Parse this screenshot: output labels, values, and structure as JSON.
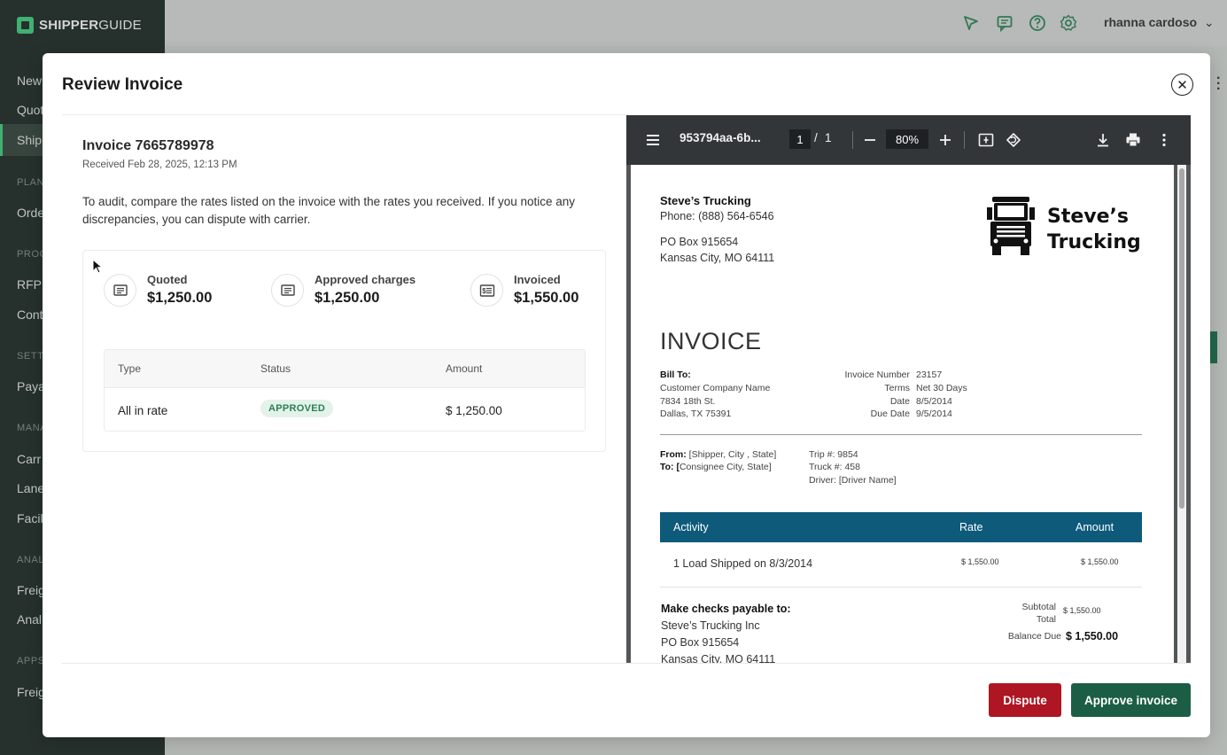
{
  "app": {
    "brand": {
      "bold": "SHIPPER",
      "thin": "GUIDE"
    },
    "user_name": "rhanna cardoso",
    "nav": [
      {
        "label": "New"
      },
      {
        "label": "Quot"
      },
      {
        "label": "Ship"
      },
      {
        "section": "PLAN"
      },
      {
        "label": "Orde"
      },
      {
        "section": "PROC"
      },
      {
        "label": "RFP"
      },
      {
        "label": "Cont"
      },
      {
        "section": "SETT"
      },
      {
        "label": "Paya"
      },
      {
        "section": "MANA"
      },
      {
        "label": "Carr"
      },
      {
        "label": "Lane"
      },
      {
        "label": "Facil"
      },
      {
        "section": "ANAL"
      },
      {
        "label": "Freig"
      },
      {
        "label": "Anal"
      },
      {
        "section": "APPS"
      },
      {
        "label": "Freig"
      }
    ]
  },
  "modal": {
    "title": "Review Invoice",
    "close_symbol": "✕",
    "invoice_title": "Invoice 7665789978",
    "received": "Received Feb 28, 2025, 12:13 PM",
    "instructions": "To audit, compare the rates listed on the invoice with the rates you received. If you notice any discrepancies, you can dispute with carrier.",
    "metrics": [
      {
        "label": "Quoted",
        "value": "$1,250.00",
        "icon": "document-lines-icon"
      },
      {
        "label": "Approved charges",
        "value": "$1,250.00",
        "icon": "document-lines-icon"
      },
      {
        "label": "Invoiced",
        "value": "$1,550.00",
        "icon": "invoice-receipt-icon"
      }
    ],
    "table": {
      "headers": [
        "Type",
        "Status",
        "Amount"
      ],
      "rows": [
        {
          "type": "All in rate",
          "status": "APPROVED",
          "amount": "$ 1,250.00"
        }
      ]
    },
    "buttons": {
      "dispute": "Dispute",
      "approve": "Approve invoice"
    }
  },
  "pdf_viewer": {
    "file_name": "953794aa-6b...",
    "page_current": "1",
    "page_separator": "/",
    "page_total": "1",
    "zoom": "80%",
    "document": {
      "company": "Steve’s Trucking",
      "phone": "Phone: (888) 564-6546",
      "address1": "PO Box 915654",
      "address2": "Kansas City, MO 64111",
      "brand_line1": "Steve’s",
      "brand_line2": "Trucking",
      "heading": "INVOICE",
      "bill_to_label": "Bill To:",
      "bill_to": [
        "Customer Company Name",
        "7834 18th St.",
        "Dallas, TX 75391"
      ],
      "meta_labels": [
        "Invoice Number",
        "Terms",
        "Date",
        "Due Date"
      ],
      "meta_values": [
        "23157",
        "Net 30 Days",
        "8/5/2014",
        "9/5/2014"
      ],
      "from_label": "From:",
      "from_value": "[Shipper, City , State]",
      "to_label": "To: [",
      "to_value": "Consignee City, State]",
      "trip": "Trip #: 9854",
      "truck": "Truck #: 458",
      "driver": "Driver: [Driver Name]",
      "activity_headers": [
        "Activity",
        "Rate",
        "Amount"
      ],
      "activity_rows": [
        {
          "activity": "1 Load Shipped on 8/3/2014",
          "rate": "$ 1,550.00",
          "amount": "$ 1,550.00"
        }
      ],
      "payable_label": "Make checks payable to:",
      "payable_lines": [
        "Steve’s Trucking Inc",
        "PO Box 915654",
        "Kansas City, MO 64111"
      ],
      "subtotal_label": "Subtotal",
      "subtotal_value": "$ 1,550.00",
      "total_label": "Total",
      "balance_label": "Balance Due",
      "balance_value": "$ 1,550.00"
    }
  },
  "colors": {
    "sidebar": "#1f2a26",
    "accent_green": "#3ec07a",
    "dispute": "#ad1622",
    "approve": "#1b5e45",
    "activity_header": "#0e5a7b"
  }
}
